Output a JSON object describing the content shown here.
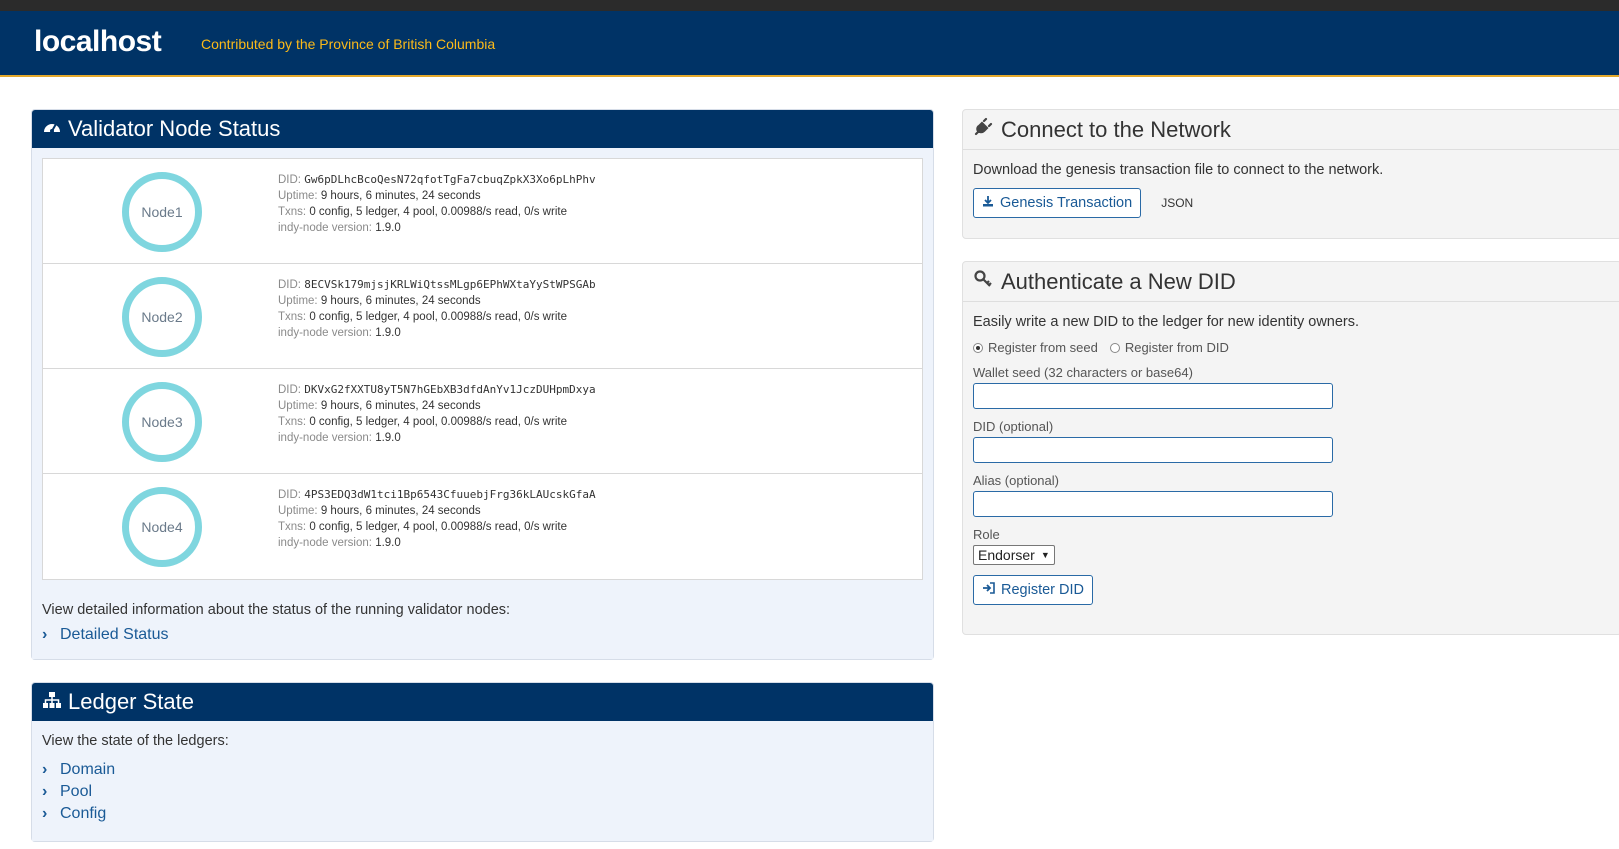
{
  "header": {
    "brand": "localhost",
    "tagline": "Contributed by the Province of British Columbia"
  },
  "validator": {
    "title": "Validator Node Status",
    "nodes": [
      {
        "name": "Node1",
        "did": "Gw6pDLhcBcoQesN72qfotTgFa7cbuqZpkX3Xo6pLhPhv",
        "uptime": "9 hours, 6 minutes, 24 seconds",
        "txns": "0 config, 5 ledger, 4 pool, 0.00988/s read, 0/s write",
        "version": "1.9.0"
      },
      {
        "name": "Node2",
        "did": "8ECVSk179mjsjKRLWiQtssMLgp6EPhWXtaYyStWPSGAb",
        "uptime": "9 hours, 6 minutes, 24 seconds",
        "txns": "0 config, 5 ledger, 4 pool, 0.00988/s read, 0/s write",
        "version": "1.9.0"
      },
      {
        "name": "Node3",
        "did": "DKVxG2fXXTU8yT5N7hGEbXB3dfdAnYv1JczDUHpmDxya",
        "uptime": "9 hours, 6 minutes, 24 seconds",
        "txns": "0 config, 5 ledger, 4 pool, 0.00988/s read, 0/s write",
        "version": "1.9.0"
      },
      {
        "name": "Node4",
        "did": "4PS3EDQ3dW1tci1Bp6543CfuuebjFrg36kLAUcskGfaA",
        "uptime": "9 hours, 6 minutes, 24 seconds",
        "txns": "0 config, 5 ledger, 4 pool, 0.00988/s read, 0/s write",
        "version": "1.9.0"
      }
    ],
    "labels": {
      "did": "DID:",
      "uptime": "Uptime:",
      "txns": "Txns:",
      "version": "indy-node version:"
    },
    "detail_text": "View detailed information about the status of the running validator nodes:",
    "detail_link": "Detailed Status"
  },
  "ledger": {
    "title": "Ledger State",
    "intro": "View the state of the ledgers:",
    "links": [
      "Domain",
      "Pool",
      "Config"
    ]
  },
  "connect": {
    "title": "Connect to the Network",
    "text": "Download the genesis transaction file to connect to the network.",
    "button": "Genesis Transaction",
    "json_link": "JSON"
  },
  "auth": {
    "title": "Authenticate a New DID",
    "text": "Easily write a new DID to the ledger for new identity owners.",
    "radio_seed": "Register from seed",
    "radio_did": "Register from DID",
    "seed_label": "Wallet seed (32 characters or base64)",
    "did_label": "DID (optional)",
    "alias_label": "Alias (optional)",
    "role_label": "Role",
    "role_value": "Endorser",
    "register_button": "Register DID"
  }
}
